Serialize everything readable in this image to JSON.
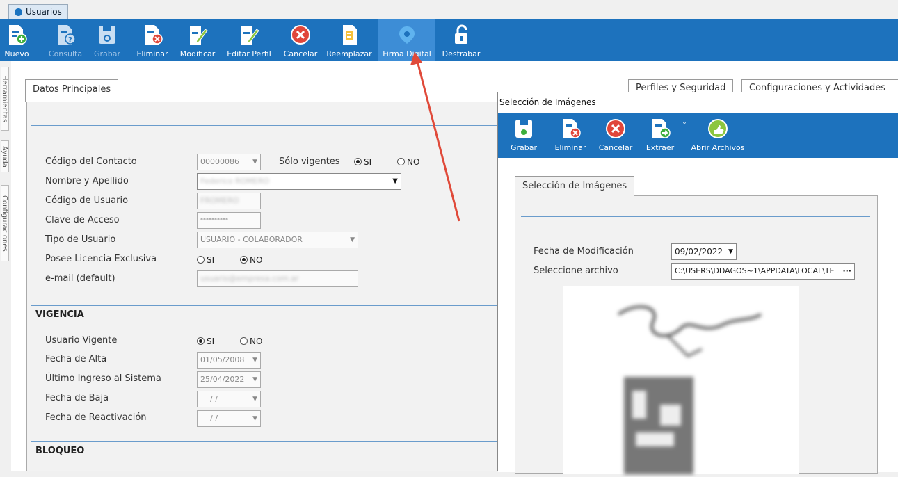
{
  "window_tab": {
    "label": "Usuarios"
  },
  "toolbar": {
    "buttons": [
      {
        "label": "Nuevo",
        "icon": "new-document-icon",
        "disabled": false
      },
      {
        "label": "Consulta",
        "icon": "query-document-icon",
        "disabled": true
      },
      {
        "label": "Grabar",
        "icon": "save-icon",
        "disabled": true
      },
      {
        "label": "Eliminar",
        "icon": "delete-document-icon",
        "disabled": false
      },
      {
        "label": "Modificar",
        "icon": "edit-pencil-icon",
        "disabled": false
      },
      {
        "label": "Editar Perfil",
        "icon": "edit-profile-icon",
        "disabled": false
      },
      {
        "label": "Cancelar",
        "icon": "cancel-icon",
        "disabled": false
      },
      {
        "label": "Reemplazar",
        "icon": "replace-document-icon",
        "disabled": false
      },
      {
        "label": "Firma Digital",
        "icon": "digital-signature-icon",
        "disabled": false
      },
      {
        "label": "Destrabar",
        "icon": "unlock-icon",
        "disabled": false
      }
    ]
  },
  "side_tabs": [
    "Herramientas",
    "Ayuda",
    "Configuraciones"
  ],
  "tabs": {
    "datos": "Datos Principales",
    "perfiles": "Perfiles y Seguridad",
    "config": "Configuraciones y Actividades"
  },
  "datos": {
    "codigo_contacto": {
      "label": "Código del Contacto",
      "value": "00000086"
    },
    "solo_vigentes": {
      "label": "Sólo vigentes",
      "si": "SI",
      "no": "NO",
      "selected": "SI"
    },
    "nombre": {
      "label": "Nombre y Apellido",
      "value": "Federico ROMERO"
    },
    "codigo_usuario": {
      "label": "Código de Usuario",
      "value": "FROMERO"
    },
    "clave": {
      "label": "Clave de Acceso",
      "value": "**********"
    },
    "tipo_usuario": {
      "label": "Tipo de Usuario",
      "value": "USUARIO - COLABORADOR"
    },
    "licencia": {
      "label": "Posee Licencia Exclusiva",
      "si": "SI",
      "no": "NO",
      "selected": "NO"
    },
    "email": {
      "label": "e-mail (default)",
      "value": "usuario@empresa.com.ar"
    }
  },
  "vigencia": {
    "title": "VIGENCIA",
    "usuario_vigente": {
      "label": "Usuario Vigente",
      "si": "SI",
      "no": "NO",
      "selected": "SI"
    },
    "fecha_alta": {
      "label": "Fecha de Alta",
      "value": "01/05/2008"
    },
    "ultimo_ingreso": {
      "label": "Último Ingreso al Sistema",
      "value": "25/04/2022"
    },
    "fecha_baja": {
      "label": "Fecha de Baja",
      "value": " /  /"
    },
    "fecha_reactivacion": {
      "label": "Fecha de Reactivación",
      "value": " /  /"
    }
  },
  "bloqueo": {
    "title": "BLOQUEO"
  },
  "dialog": {
    "title": "Selección de Imágenes",
    "toolbar": [
      {
        "label": "Grabar",
        "icon": "save-icon"
      },
      {
        "label": "Eliminar",
        "icon": "delete-document-icon"
      },
      {
        "label": "Cancelar",
        "icon": "cancel-icon"
      },
      {
        "label": "Extraer",
        "icon": "extract-document-icon"
      },
      {
        "label": "Abrir Archivos",
        "icon": "open-files-icon"
      }
    ],
    "tab": "Selección de Imágenes",
    "fecha_modificacion": {
      "label": "Fecha de Modificación",
      "value": "09/02/2022"
    },
    "seleccione_archivo": {
      "label": "Seleccione archivo",
      "value": "C:\\USERS\\DDAGOS~1\\APPDATA\\LOCAL\\TE"
    },
    "browse": "···"
  },
  "colors": {
    "toolbar_blue": "#1d72bd",
    "rule_blue": "#6a9ccc",
    "annotation_red": "#e04a3a"
  }
}
